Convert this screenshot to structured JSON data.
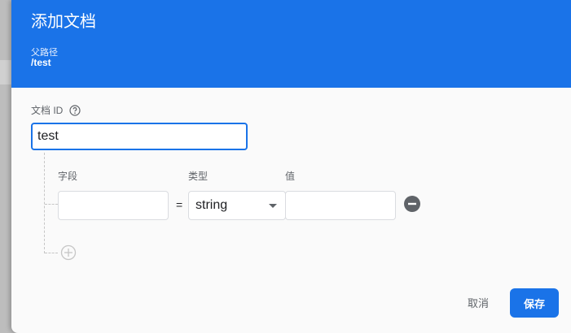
{
  "dialog": {
    "title": "添加文档",
    "parent_path_label": "父路径",
    "parent_path_value": "/test"
  },
  "document_id": {
    "label": "文档 ID",
    "value": "test",
    "help_icon": "help-circle-icon"
  },
  "fields": {
    "headers": {
      "field": "字段",
      "type": "类型",
      "value": "值"
    },
    "rows": [
      {
        "field": "",
        "equals": "=",
        "type": "string",
        "value": ""
      }
    ],
    "remove_icon": "remove-circle-icon",
    "add_icon": "add-circle-icon"
  },
  "actions": {
    "cancel": "取消",
    "save": "保存"
  },
  "colors": {
    "accent": "#1a73e8",
    "remove": "#5f6368"
  }
}
